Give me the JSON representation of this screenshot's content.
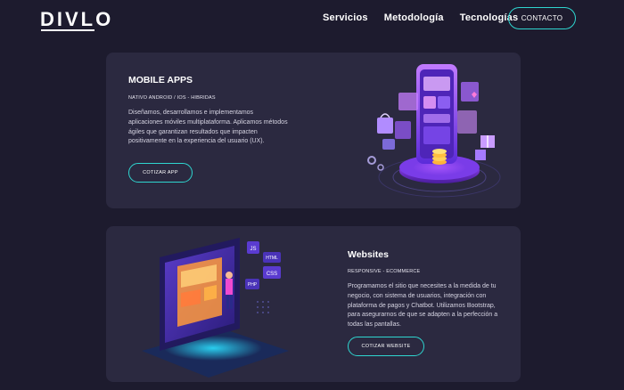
{
  "header": {
    "logo": "DIVLO",
    "nav": [
      "Servicios",
      "Metodología",
      "Tecnologías"
    ],
    "contact_label": "CONTACTO"
  },
  "cards": [
    {
      "title": "MOBILE APPS",
      "subtitle": "NATIVO ANDROID / IOS - HIBRIDAS",
      "description": "Diseñamos, desarrollamos e implementamos aplicaciones móviles multiplataforma. Aplicamos métodos ágiles que garantizan resultados que impacten positivamente en la experiencia del usuario (UX).",
      "button": "COTIZAR APP"
    },
    {
      "title": "Websites",
      "subtitle": "RESPONSIVE - ECOMMERCE",
      "description": "Programamos el sitio que necesites a la medida de tu negocio, con sistema de usuarios, integración con plataforma de pagos y Chatbot. Utilizamos Bootstrap, para asegurarnos de que se adapten a la perfección a todas las pantallas.",
      "button": "COTIZAR WEBSITE",
      "code_tags": [
        "JS",
        "HTML",
        "CSS",
        "PHP"
      ]
    }
  ],
  "colors": {
    "background": "#1d1b2e",
    "card": "#2b2940",
    "accent": "#2fd6d0",
    "purple": "#8f4fff"
  }
}
